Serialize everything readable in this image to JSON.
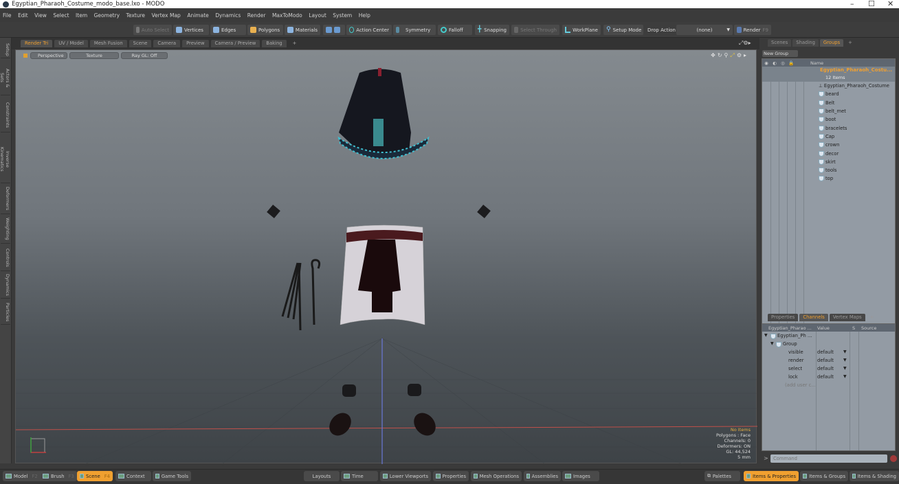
{
  "window": {
    "title": "Egyptian_Pharaoh_Costume_modo_base.lxo - MODO",
    "controls": [
      "–",
      "☐",
      "✕"
    ]
  },
  "menu": [
    "File",
    "Edit",
    "View",
    "Select",
    "Item",
    "Geometry",
    "Texture",
    "Vertex Map",
    "Animate",
    "Dynamics",
    "Render",
    "MaxToModo",
    "Layout",
    "System",
    "Help"
  ],
  "toolbar": {
    "auto_select": "Auto Select",
    "vertices": "Vertices",
    "edges": "Edges",
    "polygons": "Polygons",
    "materials": "Materials",
    "action_center": "Action Center",
    "symmetry": "Symmetry",
    "falloff": "Falloff",
    "snapping": "Snapping",
    "select_through": "Select Through",
    "workplane": "WorkPlane",
    "setup_mode": "Setup Mode",
    "drop_action_label": "Drop Action",
    "drop_action_value": "(none)",
    "render": "Render",
    "render_key": "F9"
  },
  "left_tabs": [
    "Setup",
    "Actors & Sets",
    "Constraints",
    "Inverse Kinematics",
    "Deformers",
    "Weighting",
    "Controls",
    "Dynamics",
    "Particles"
  ],
  "viewport_tabs": [
    {
      "label": "Render Tri",
      "active": true
    },
    {
      "label": "UV / Model"
    },
    {
      "label": "Mesh Fusion"
    },
    {
      "label": "Scene"
    },
    {
      "label": "Camera"
    },
    {
      "label": "Preview"
    },
    {
      "label": "Camera / Preview"
    },
    {
      "label": "Baking"
    },
    {
      "label": "+"
    }
  ],
  "viewport": {
    "view": "Perspective",
    "shading": "Texture",
    "raygl": "Ray GL: Off",
    "info": {
      "selection": "No Items",
      "polygons": "Polygons : Face",
      "channels": "Channels: 0",
      "deformers": "Deformers: ON",
      "gl": "GL: 44,524",
      "unit": "5 mm"
    }
  },
  "right_tabs": [
    {
      "label": "Scenes"
    },
    {
      "label": "Shading"
    },
    {
      "label": "Groups",
      "active": true
    },
    {
      "label": "+"
    }
  ],
  "groups": {
    "new_group": "New Group",
    "name_header": "Name",
    "group_name": "Egyptian_Pharaoh_Costu...",
    "group_count": "12 Items",
    "items": [
      "Egyptian_Pharaoh_Costume",
      "beard",
      "Belt",
      "belt_met",
      "boot",
      "bracelets",
      "Cap",
      "crown",
      "decor",
      "skirt",
      "tools",
      "top"
    ]
  },
  "lower_tabs": [
    {
      "label": "Properties"
    },
    {
      "label": "Channels",
      "active": true
    },
    {
      "label": "Vertex Maps"
    },
    {
      "label": "+"
    }
  ],
  "channels": {
    "headers": {
      "name": "Egyptian_Pharao ...",
      "value": "Value",
      "s": "S",
      "source": "Source"
    },
    "root": "Egyptian_Ph ...",
    "group": "Group",
    "rows": [
      {
        "name": "visible",
        "value": "default"
      },
      {
        "name": "render",
        "value": "default"
      },
      {
        "name": "select",
        "value": "default"
      },
      {
        "name": "lock",
        "value": "default"
      }
    ],
    "add": "(add user c..."
  },
  "command": {
    "placeholder": "Command"
  },
  "bottom": {
    "left": [
      {
        "label": "Model",
        "key": "F2"
      },
      {
        "label": "Brush",
        "key": "F3"
      },
      {
        "label": "Scene",
        "key": "F4",
        "active": true
      },
      {
        "label": "Context"
      },
      {
        "label": "Game Tools"
      }
    ],
    "center": [
      "Layouts",
      "Time",
      "Lower Viewports",
      "Properties",
      "Mesh Operations",
      "Assemblies",
      "Images"
    ],
    "right": [
      {
        "label": "Palettes"
      },
      {
        "label": "Items & Properties",
        "active": true
      },
      {
        "label": "Items & Groups"
      },
      {
        "label": "Items & Shading"
      }
    ]
  },
  "colors": {
    "accent": "#f0a030",
    "panel": "#939ba4",
    "viewport_top": "#848a8f"
  }
}
